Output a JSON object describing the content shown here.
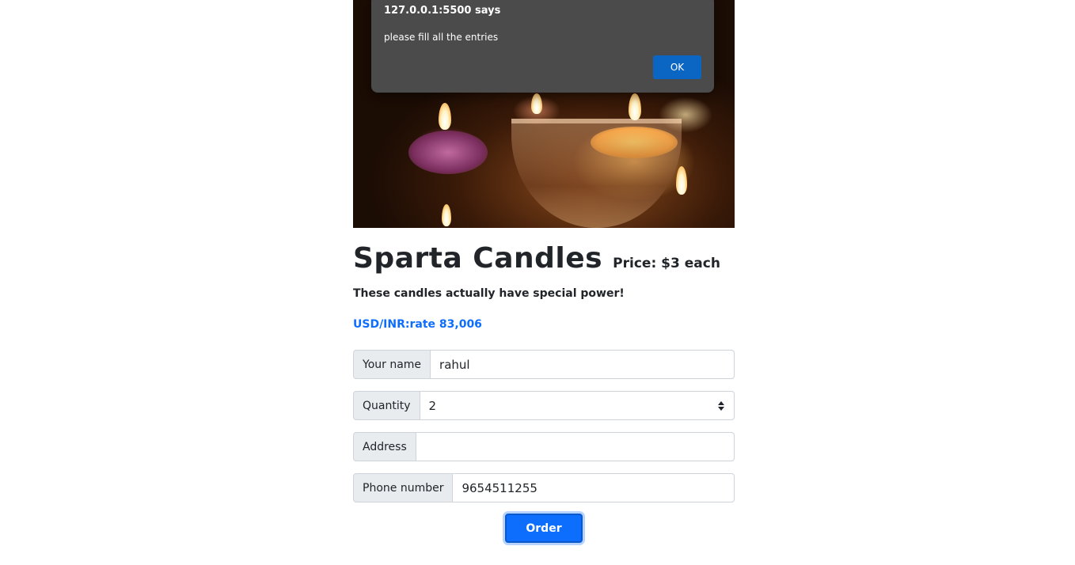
{
  "alert": {
    "title": "127.0.0.1:5500 says",
    "message": "please fill all the entries",
    "ok_label": "OK"
  },
  "product": {
    "title": "Sparta Candles",
    "price": "Price: $3 each",
    "tagline": "These candles actually have special power!",
    "rate": "USD/INR:rate 83,006"
  },
  "form": {
    "name_label": "Your name",
    "name_value": "rahul",
    "quantity_label": "Quantity",
    "quantity_value": "2",
    "address_label": "Address",
    "address_value": "",
    "phone_label": "Phone number",
    "phone_value": "9654511255",
    "order_label": "Order"
  },
  "colors": {
    "accent": "#0d6efd",
    "dialog_bg": "#4b4b4b",
    "dialog_button": "#0b66c3"
  }
}
